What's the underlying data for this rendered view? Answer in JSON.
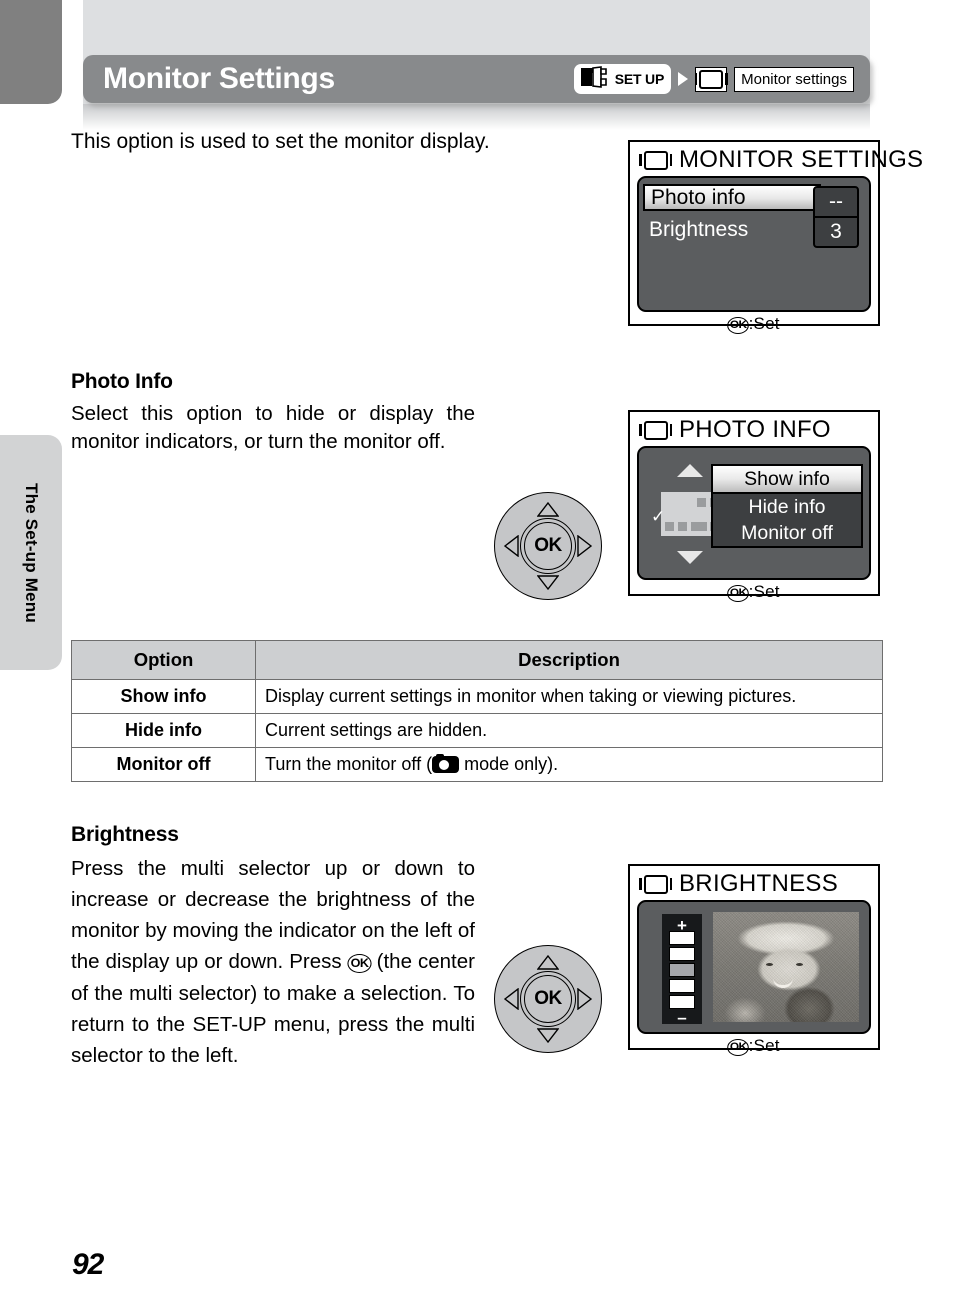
{
  "header": {
    "title": "Monitor Settings",
    "breadcrumb": {
      "setup_label": "SET UP",
      "monitor_icon": "monitor-icon",
      "arrow_icon": "breadcrumb-arrow-icon",
      "target_label": "Monitor settings"
    }
  },
  "sidebar": {
    "tab_label": "The Set-up Menu"
  },
  "intro": {
    "text": "This option is used to set the monitor display."
  },
  "sections": {
    "photo_info": {
      "heading": "Photo Info",
      "body": "Select this option to hide or display the monitor indicators, or turn the monitor off."
    },
    "brightness": {
      "heading": "Brightness",
      "body_part1": "Press the multi selector up or down to increase or decrease the brightness of the monitor by moving the indicator on the left of the display up or down. Press ",
      "ok_glyph": "OK",
      "body_part2": " (the center of the multi selector) to make a selection. To return to the SET-UP menu, press the multi selector to the left."
    }
  },
  "table": {
    "headers": [
      "Option",
      "Description"
    ],
    "rows": [
      {
        "option": "Show info",
        "description": "Display current settings in monitor when taking or viewing pictures."
      },
      {
        "option": "Hide info",
        "description": "Current settings are hidden."
      },
      {
        "option": "Monitor off",
        "description_part1": "Turn the monitor off (",
        "camera_icon": "camera-mode-icon",
        "description_part2": " mode only)."
      }
    ]
  },
  "lcd_monitor_settings": {
    "title": "MONITOR SETTINGS",
    "items": [
      {
        "label": "Photo info",
        "value": "--",
        "selected": true
      },
      {
        "label": "Brightness",
        "value": "3",
        "selected": false
      }
    ],
    "footer_ok": "OK",
    "footer_text": ":Set"
  },
  "lcd_photo_info": {
    "title": "PHOTO INFO",
    "options": [
      {
        "label": "Show info",
        "selected": true
      },
      {
        "label": "Hide info",
        "selected": false
      },
      {
        "label": "Monitor off",
        "selected": false
      }
    ],
    "footer_ok": "OK",
    "footer_text": ":Set"
  },
  "lcd_brightness": {
    "title": "BRIGHTNESS",
    "plus_label": "+",
    "minus_label": "–",
    "scale_cells": 5,
    "active_cell": 3,
    "footer_ok": "OK",
    "footer_text": ":Set"
  },
  "multi_selector": {
    "center_label": "OK",
    "up_icon": "triangle-up-icon",
    "down_icon": "triangle-down-icon",
    "left_icon": "triangle-left-icon",
    "right_icon": "triangle-right-icon"
  },
  "page": {
    "number": "92"
  },
  "colors": {
    "header_bar": "#888a8c",
    "top_block": "#dddfe1",
    "corner_tab": "#808080",
    "side_tab": "#d2d3d4",
    "table_header": "#cdcfd1",
    "lcd_screen": "#5b5d5f",
    "lcd_panel": "#3d3f41",
    "selector_face": "#c5c6c8"
  }
}
